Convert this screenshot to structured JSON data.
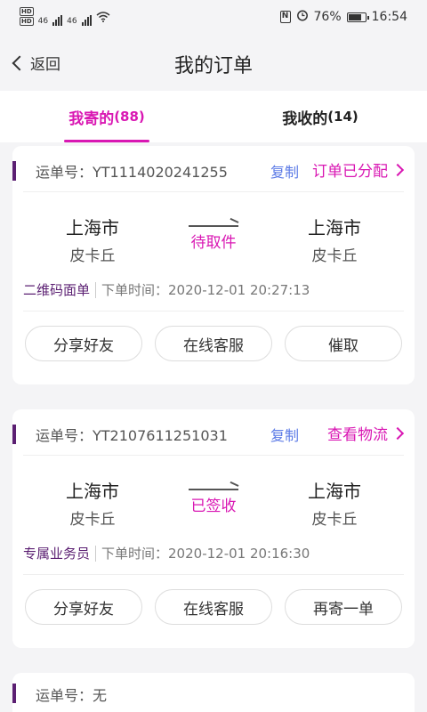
{
  "status_bar": {
    "left": {
      "hd1": "HD",
      "hd2": "HD",
      "net1": "46",
      "net2": "46"
    },
    "nfc": "N",
    "battery": "76%",
    "time": "16:54"
  },
  "nav": {
    "back_label": "返回",
    "title": "我的订单"
  },
  "tabs": [
    {
      "label": "我寄的",
      "count": "(88)",
      "active": true
    },
    {
      "label": "我收的",
      "count": "(14)",
      "active": false
    }
  ],
  "orders": [
    {
      "waybill": "运单号：YT1114020241255",
      "copy_label": "复制",
      "status_link": "订单已分配",
      "from_city": "上海市",
      "from_district": "皮卡丘",
      "mid_status": "待取件",
      "to_city": "上海市",
      "to_district": "皮卡丘",
      "tag": "二维码面单",
      "time": "下单时间：2020-12-01 20:27:13",
      "actions": [
        "分享好友",
        "在线客服",
        "催取"
      ]
    },
    {
      "waybill": "运单号：YT2107611251031",
      "copy_label": "复制",
      "status_link": "查看物流",
      "from_city": "上海市",
      "from_district": "皮卡丘",
      "mid_status": "已签收",
      "to_city": "上海市",
      "to_district": "皮卡丘",
      "tag": "专属业务员",
      "time": "下单时间：2020-12-01 20:16:30",
      "actions": [
        "分享好友",
        "在线客服",
        "再寄一单"
      ]
    },
    {
      "waybill": "运单号：无"
    }
  ],
  "colors": {
    "accent": "#d917b3",
    "tag_purple": "#5b1f72",
    "copy_blue": "#5b7ae6",
    "background": "#f4f4f6"
  }
}
